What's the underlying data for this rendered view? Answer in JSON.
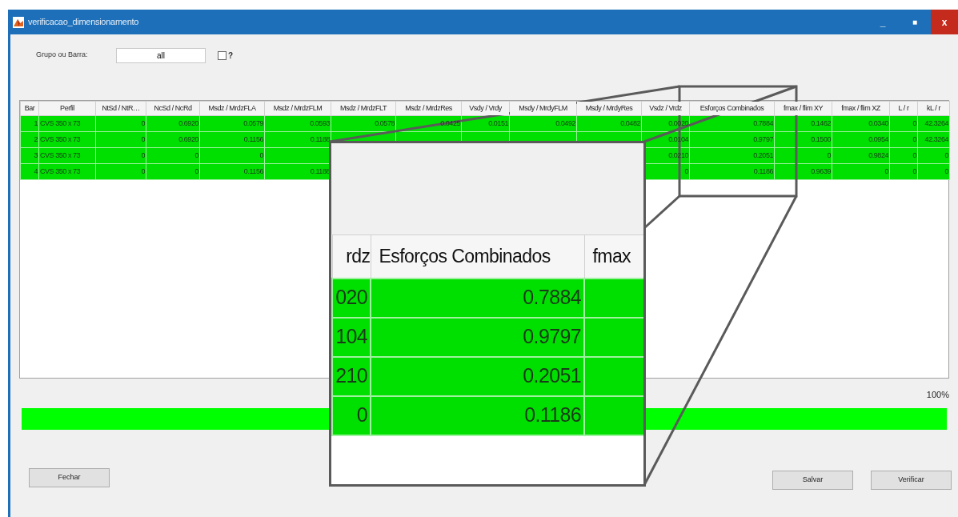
{
  "window": {
    "title": "verificacao_dimensionamento",
    "controls": [
      "_",
      "■",
      "x"
    ]
  },
  "filter": {
    "label": "Grupo ou Barra:",
    "value": "all",
    "checkbox_label": "?",
    "checked": false
  },
  "table": {
    "columns": [
      "Bar",
      "Perfil",
      "NtSd / NtR…",
      "NcSd / NcRd",
      "Msdz / MrdzFLA",
      "Msdz / MrdzFLM",
      "Msdz / MrdzFLT",
      "Msdz / MrdzRes",
      "Vsdy / Vrdy",
      "Msdy / MrdyFLM",
      "Msdy / MrdyRes",
      "Vsdz / Vrdz",
      "Esforços Combinados",
      "fmax / flim XY",
      "fmax / flim XZ",
      "L / r",
      "kL / r"
    ],
    "rows": [
      {
        "cells": [
          "1",
          "CVS 350 x 73",
          "0",
          "0.6920",
          "0.0579",
          "0.0593",
          "0.0578",
          "0.0425",
          "0.0151",
          "0.0492",
          "0.0482",
          "0.0020",
          "0.7884",
          "0.1462",
          "0.0340",
          "0",
          "42.3264"
        ]
      },
      {
        "cells": [
          "2",
          "CVS 350 x 73",
          "0",
          "0.6920",
          "0.1156",
          "0.1188",
          null,
          null,
          null,
          null,
          null,
          "0.0104",
          "0.9797",
          "0.1500",
          "0.0954",
          "0",
          "42.3264"
        ]
      },
      {
        "cells": [
          "3",
          "CVS 350 x 73",
          "0",
          "0",
          "0",
          null,
          null,
          null,
          null,
          null,
          null,
          "0.0210",
          "0.2051",
          "0",
          "0.9824",
          "0",
          "0"
        ]
      },
      {
        "cells": [
          "4",
          "CVS 350 x 73",
          "0",
          "0",
          "0.1156",
          "0.1188",
          null,
          null,
          null,
          null,
          null,
          "0",
          "0.1186",
          "0.9639",
          "0",
          "0",
          "0"
        ]
      }
    ]
  },
  "magnifier": {
    "columns": [
      "rdz",
      "Esforços Combinados",
      "fmax"
    ],
    "rows": [
      [
        "020",
        "0.7884"
      ],
      [
        "104",
        "0.9797"
      ],
      [
        "210",
        "0.2051"
      ],
      [
        "0",
        "0.1186"
      ]
    ]
  },
  "progress": {
    "label": "100%",
    "level": 1
  },
  "buttons": [
    "Fechar",
    "Salvar",
    "Verificar"
  ]
}
